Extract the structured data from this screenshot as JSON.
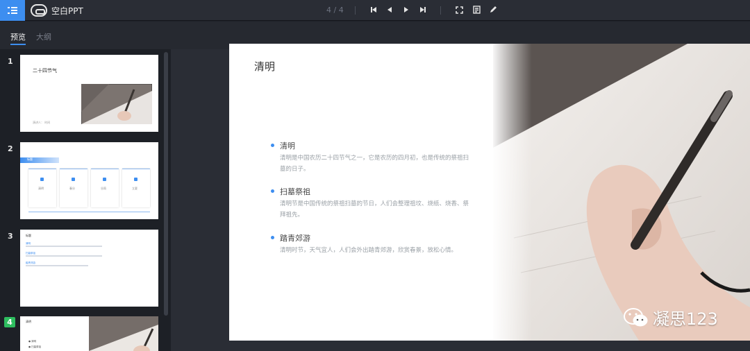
{
  "app": {
    "title": "空白PPT"
  },
  "toolbar": {
    "pager": "4 / 4",
    "icons": [
      "menu-icon",
      "first-slide-icon",
      "prev-slide-icon",
      "next-slide-icon",
      "last-slide-icon",
      "fullscreen-icon",
      "notes-icon",
      "edit-icon"
    ]
  },
  "tabs": [
    {
      "label": "预览",
      "active": true
    },
    {
      "label": "大纲",
      "active": false
    }
  ],
  "thumbnails": [
    {
      "number": "1",
      "title": "二十四节气",
      "caption": "演讲人：  时间"
    },
    {
      "number": "2",
      "title": "标题",
      "cards": [
        "清明",
        "春分",
        "谷雨",
        "立夏"
      ]
    },
    {
      "number": "3",
      "title": "标题",
      "lines": [
        "清明",
        "扫墓祭祖",
        "踏青郊游"
      ]
    },
    {
      "number": "4",
      "title": "清明",
      "lines": [
        "● 清明",
        "● 扫墓祭祖"
      ]
    }
  ],
  "slide": {
    "title": "清明",
    "bullets": [
      {
        "title": "清明",
        "body": "清明是中国农历二十四节气之一，它是农历的四月初，也是传统的祭祖扫墓的日子。"
      },
      {
        "title": "扫墓祭祖",
        "body": "清明节是中国传统的祭祖扫墓的节日，人们会整理祖坟、烧纸、烧香、祭拜祖先。"
      },
      {
        "title": "踏青郊游",
        "body": "清明时节，天气宜人，人们会外出踏青郊游，欣赏春景，放松心情。"
      }
    ]
  },
  "watermark": {
    "text": "凝思123",
    "icon": "wechat-icon"
  },
  "colors": {
    "accent": "#3d8ef0",
    "active_badge": "#2ebd5f",
    "background": "#1f2229"
  }
}
